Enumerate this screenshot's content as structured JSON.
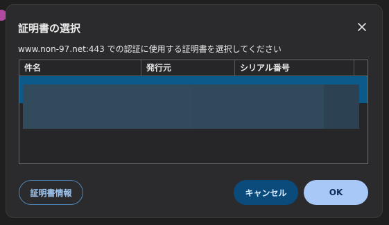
{
  "dialog": {
    "title": "証明書の選択",
    "message": "www.non-97.net:443 での認証に使用する証明書を選択してください",
    "close_icon": "close-icon"
  },
  "table": {
    "columns": [
      "件名",
      "発行元",
      "シリアル番号",
      ""
    ],
    "rows": [
      {
        "subject": "",
        "issuer": "",
        "serial": "",
        "selected": true
      }
    ]
  },
  "buttons": {
    "cert_info_label": "証明書情報",
    "cancel_label": "キャンセル",
    "ok_label": "OK"
  },
  "colors": {
    "dialog_bg": "#2b2b2d",
    "selected_row": "#0b5a8a",
    "ok_bg": "#a8c8f8",
    "cancel_bg": "#0b4b7c",
    "outline_accent": "#4d86b8"
  }
}
